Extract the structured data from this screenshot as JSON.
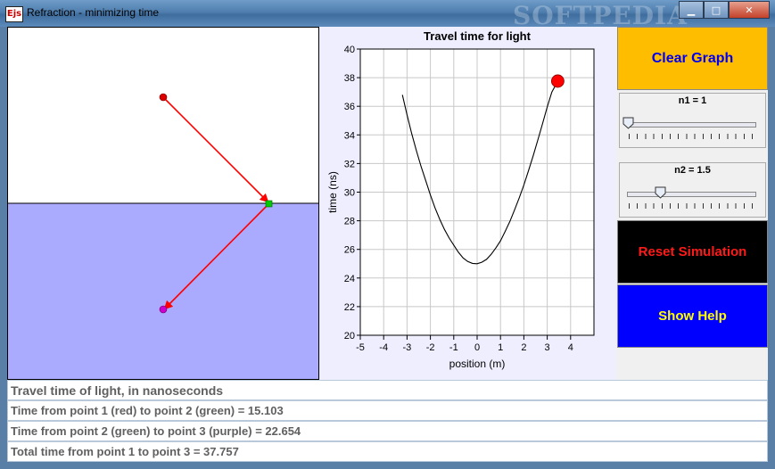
{
  "window": {
    "title": "Refraction - minimizing time",
    "icon_text": "Ejs",
    "watermark": "SOFTPEDIA",
    "min_glyph": "▁",
    "max_glyph": "□",
    "close_glyph": "✕"
  },
  "plot": {
    "title": "Travel time for light",
    "xlabel": "position (m)",
    "ylabel": "time (ns)"
  },
  "chart_data": {
    "type": "line",
    "title": "Travel time for light",
    "xlabel": "position (m)",
    "ylabel": "time (ns)",
    "xlim": [
      -5,
      5
    ],
    "ylim": [
      20,
      40
    ],
    "xticks": [
      -5,
      -4,
      -3,
      -2,
      -1,
      0,
      1,
      2,
      3,
      4
    ],
    "yticks": [
      20,
      22,
      24,
      26,
      28,
      30,
      32,
      34,
      36,
      38,
      40
    ],
    "grid": true,
    "series": [
      {
        "x": [
          -3.2,
          -3.0,
          -2.8,
          -2.6,
          -2.4,
          -2.2,
          -2.0,
          -1.8,
          -1.6,
          -1.4,
          -1.2,
          -1.0,
          -0.8,
          -0.6,
          -0.4,
          -0.2,
          0.0,
          0.2,
          0.4,
          0.6,
          0.8,
          1.0,
          1.2,
          1.4,
          1.6,
          1.8,
          2.0,
          2.2,
          2.4,
          2.6,
          2.8,
          3.0,
          3.2,
          3.4
        ],
        "y": [
          36.8,
          35.4,
          34.1,
          32.9,
          31.8,
          30.8,
          29.8,
          28.9,
          28.1,
          27.4,
          26.8,
          26.3,
          25.8,
          25.4,
          25.15,
          25.02,
          25.0,
          25.1,
          25.3,
          25.65,
          26.1,
          26.6,
          27.25,
          27.95,
          28.75,
          29.6,
          30.5,
          31.5,
          32.55,
          33.65,
          34.8,
          35.95,
          37.0,
          37.6
        ]
      }
    ],
    "marker": {
      "x": 3.45,
      "y": 37.76,
      "color": "#ff0000"
    }
  },
  "controls": {
    "clear_graph": "Clear Graph",
    "reset_simulation": "Reset Simulation",
    "show_help": "Show Help",
    "n1": {
      "label": "n1 = 1",
      "value": 1,
      "min": 1,
      "max": 3
    },
    "n2": {
      "label": "n2 = 1.5",
      "value": 1.5,
      "min": 1,
      "max": 3
    }
  },
  "simulation": {
    "colors": {
      "top_medium": "#ffffff",
      "bottom_medium": "#aaaaff",
      "ray": "#ff0000",
      "p1": "#dd0000",
      "p2": "#00cc00",
      "p3": "#cc00cc"
    }
  },
  "info": {
    "heading": "Travel time of light, in nanoseconds",
    "line1": "Time from point 1 (red) to point 2 (green) = 15.103",
    "line2": "Time from point 2 (green) to point 3 (purple) = 22.654",
    "line3": "Total time from point 1 to point 3 = 37.757"
  }
}
